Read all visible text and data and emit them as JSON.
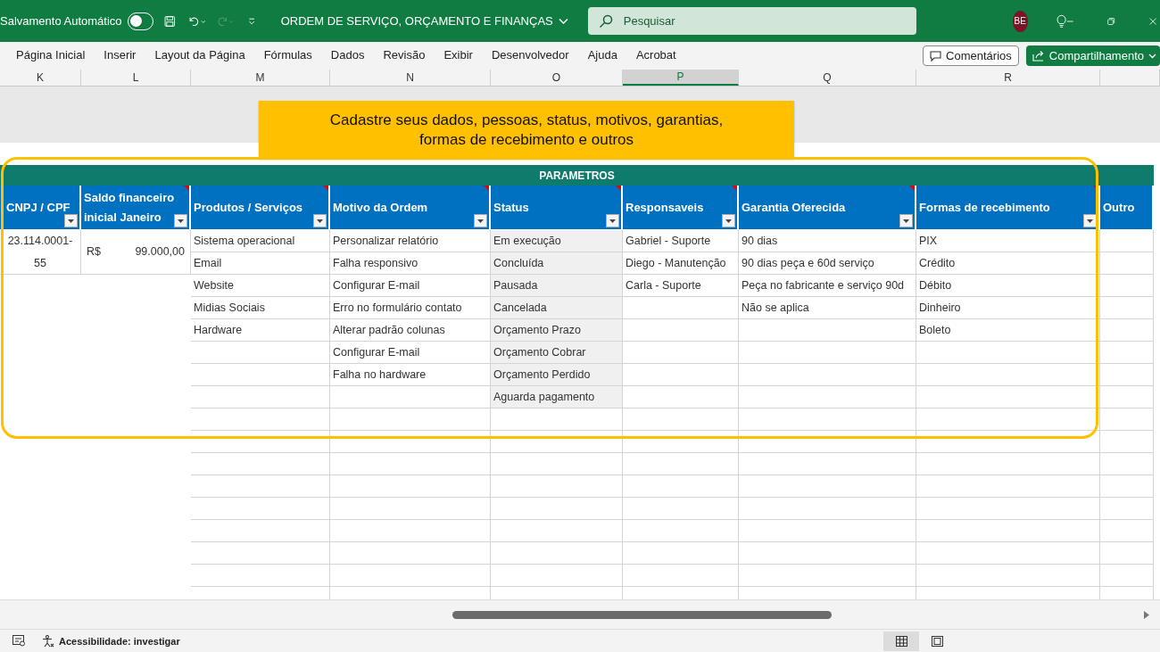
{
  "titlebar": {
    "autosave_label": "Salvamento Automático",
    "autosave_on": false,
    "redo_disabled": true,
    "document_title": "ORDEM DE SERVIÇO, ORÇAMENTO E FINANÇAS",
    "search": {
      "placeholder": "Pesquisar"
    },
    "avatar": "BE"
  },
  "ribbon": {
    "tabs": [
      {
        "label": "Página Inicial",
        "selected": false
      },
      {
        "label": "Inserir",
        "selected": false
      },
      {
        "label": "Layout da Página",
        "selected": false
      },
      {
        "label": "Fórmulas",
        "selected": false
      },
      {
        "label": "Dados",
        "selected": false
      },
      {
        "label": "Revisão",
        "selected": false
      },
      {
        "label": "Exibir",
        "selected": false
      },
      {
        "label": "Desenvolvedor",
        "selected": false
      },
      {
        "label": "Ajuda",
        "selected": false
      },
      {
        "label": "Acrobat",
        "selected": false
      }
    ],
    "comments_button": "Comentários",
    "share_button": "Compartilhamento"
  },
  "column_letters": [
    {
      "label": "K",
      "selected": false
    },
    {
      "label": "L",
      "selected": false
    },
    {
      "label": "M",
      "selected": false
    },
    {
      "label": "N",
      "selected": false
    },
    {
      "label": "O",
      "selected": false
    },
    {
      "label": "P",
      "selected": true
    },
    {
      "label": "Q",
      "selected": false
    },
    {
      "label": "R",
      "selected": false
    }
  ],
  "callout": "Cadastre seus dados, pessoas, status, motivos, garantias, formas de recebimento e outros",
  "section_title": "PARAMETROS",
  "table": {
    "columns": [
      {
        "header": "CNPJ / CPF",
        "kind": "record",
        "filter": true,
        "comment": false,
        "shaded": false,
        "cells": [
          "23.114.0001-55"
        ]
      },
      {
        "header": "Saldo financeiro inicial Janeiro",
        "kind": "money",
        "filter": true,
        "comment": true,
        "shaded": false,
        "cells": [
          {
            "currency": "R$",
            "amount": "99.000,00"
          }
        ]
      },
      {
        "header": "Produtos / Serviços",
        "kind": "list",
        "filter": true,
        "comment": true,
        "shaded": false,
        "cells": [
          "Sistema operacional",
          "Email",
          "Website",
          "Midias Sociais",
          "Hardware"
        ]
      },
      {
        "header": "Motivo da Ordem",
        "kind": "list",
        "filter": true,
        "comment": true,
        "shaded": false,
        "cells": [
          "Personalizar relatório",
          "Falha responsivo",
          "Configurar E-mail",
          "Erro no formulário contato",
          "Alterar padrão colunas",
          "Configurar E-mail",
          "Falha no hardware"
        ]
      },
      {
        "header": "Status",
        "kind": "list",
        "filter": true,
        "comment": true,
        "shaded": true,
        "cells": [
          "Em execução",
          "Concluída",
          "Pausada",
          "Cancelada",
          "Orçamento Prazo",
          "Orçamento Cobrar",
          "Orçamento Perdido",
          "Aguarda pagamento"
        ]
      },
      {
        "header": "Responsaveis",
        "kind": "list",
        "filter": true,
        "comment": true,
        "shaded": false,
        "cells": [
          "Gabriel - Suporte",
          "Diego - Manutenção",
          "Carla - Suporte"
        ]
      },
      {
        "header": "Garantia Oferecida",
        "kind": "list",
        "filter": true,
        "comment": true,
        "shaded": false,
        "cells": [
          "90 dias",
          "90 dias peça e 60d serviço",
          "Peça no fabricante e serviço 90d",
          "Não se aplica"
        ]
      },
      {
        "header": "Formas de recebimento",
        "kind": "list",
        "filter": true,
        "comment": true,
        "shaded": false,
        "cells": [
          "PIX",
          "Crédito",
          "Débito",
          "Dinheiro",
          "Boleto"
        ]
      },
      {
        "header": "Outro",
        "kind": "list",
        "filter": false,
        "comment": false,
        "shaded": false
      }
    ]
  },
  "status_bar": {
    "accessibility": "Acessibilidade: investigar",
    "views": [
      {
        "kind": "normal",
        "selected": true
      },
      {
        "kind": "page-layout",
        "selected": false
      }
    ]
  }
}
